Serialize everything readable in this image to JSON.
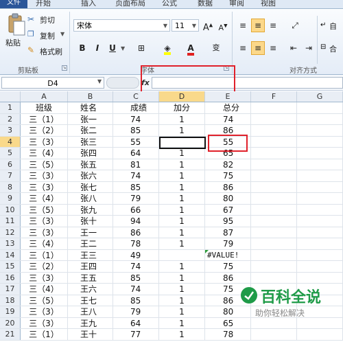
{
  "ribbon": {
    "tabs": [
      "文件",
      "开始",
      "插入",
      "页面布局",
      "公式",
      "数据",
      "审阅",
      "视图"
    ],
    "clipboard": {
      "paste": "粘贴",
      "cut": "剪切",
      "copy": "复制",
      "format_painter": "格式刷",
      "group": "剪贴板"
    },
    "font": {
      "name": "宋体",
      "size": "11",
      "group": "字体",
      "bold": "B",
      "italic": "I",
      "underline": "U",
      "pinyin": "变"
    },
    "alignment": {
      "wrap": "自",
      "merge": "合",
      "group": "对齐方式"
    }
  },
  "formula_bar": {
    "name_box": "D4",
    "fx": "fx",
    "content": ""
  },
  "columns": [
    "A",
    "B",
    "C",
    "D",
    "E",
    "F",
    "G"
  ],
  "active_cell": {
    "col": "D",
    "row": 4
  },
  "rows": [
    {
      "n": "1",
      "a": "班级",
      "b": "姓名",
      "c": "成绩",
      "d": "加分",
      "e": "总分"
    },
    {
      "n": "2",
      "a": "三（1）",
      "b": "张一",
      "c": "74",
      "d": "1",
      "e": "74"
    },
    {
      "n": "3",
      "a": "三（2）",
      "b": "张二",
      "c": "85",
      "d": "1",
      "e": "86"
    },
    {
      "n": "4",
      "a": "三（3）",
      "b": "张三",
      "c": "55",
      "d": "",
      "e": "55"
    },
    {
      "n": "5",
      "a": "三（4）",
      "b": "张四",
      "c": "64",
      "d": "1",
      "e": "65"
    },
    {
      "n": "6",
      "a": "三（5）",
      "b": "张五",
      "c": "81",
      "d": "1",
      "e": "82"
    },
    {
      "n": "7",
      "a": "三（3）",
      "b": "张六",
      "c": "74",
      "d": "1",
      "e": "75"
    },
    {
      "n": "8",
      "a": "三（3）",
      "b": "张七",
      "c": "85",
      "d": "1",
      "e": "86"
    },
    {
      "n": "9",
      "a": "三（4）",
      "b": "张八",
      "c": "79",
      "d": "1",
      "e": "80"
    },
    {
      "n": "10",
      "a": "三（5）",
      "b": "张九",
      "c": "66",
      "d": "1",
      "e": "67"
    },
    {
      "n": "11",
      "a": "三（3）",
      "b": "张十",
      "c": "94",
      "d": "1",
      "e": "95"
    },
    {
      "n": "12",
      "a": "三（3）",
      "b": "王一",
      "c": "86",
      "d": "1",
      "e": "87"
    },
    {
      "n": "13",
      "a": "三（4）",
      "b": "王二",
      "c": "78",
      "d": "1",
      "e": "79"
    },
    {
      "n": "14",
      "a": "三（1）",
      "b": "王三",
      "c": "49",
      "d": "",
      "e": "#VALUE!"
    },
    {
      "n": "15",
      "a": "三（2）",
      "b": "王四",
      "c": "74",
      "d": "1",
      "e": "75"
    },
    {
      "n": "16",
      "a": "三（3）",
      "b": "王五",
      "c": "85",
      "d": "1",
      "e": "86"
    },
    {
      "n": "17",
      "a": "三（4）",
      "b": "王六",
      "c": "74",
      "d": "1",
      "e": "75"
    },
    {
      "n": "18",
      "a": "三（5）",
      "b": "王七",
      "c": "85",
      "d": "1",
      "e": "86"
    },
    {
      "n": "19",
      "a": "三（3）",
      "b": "王八",
      "c": "79",
      "d": "1",
      "e": "80"
    },
    {
      "n": "20",
      "a": "三（3）",
      "b": "王九",
      "c": "64",
      "d": "1",
      "e": "65"
    },
    {
      "n": "21",
      "a": "三（1）",
      "b": "王十",
      "c": "77",
      "d": "1",
      "e": "78"
    }
  ],
  "watermark": {
    "title": "百科全说",
    "subtitle": "助你轻松解决"
  },
  "colors": {
    "highlight": "#e0202a",
    "active_header": "#f9d98b",
    "watermark_green": "#1f9b48"
  }
}
